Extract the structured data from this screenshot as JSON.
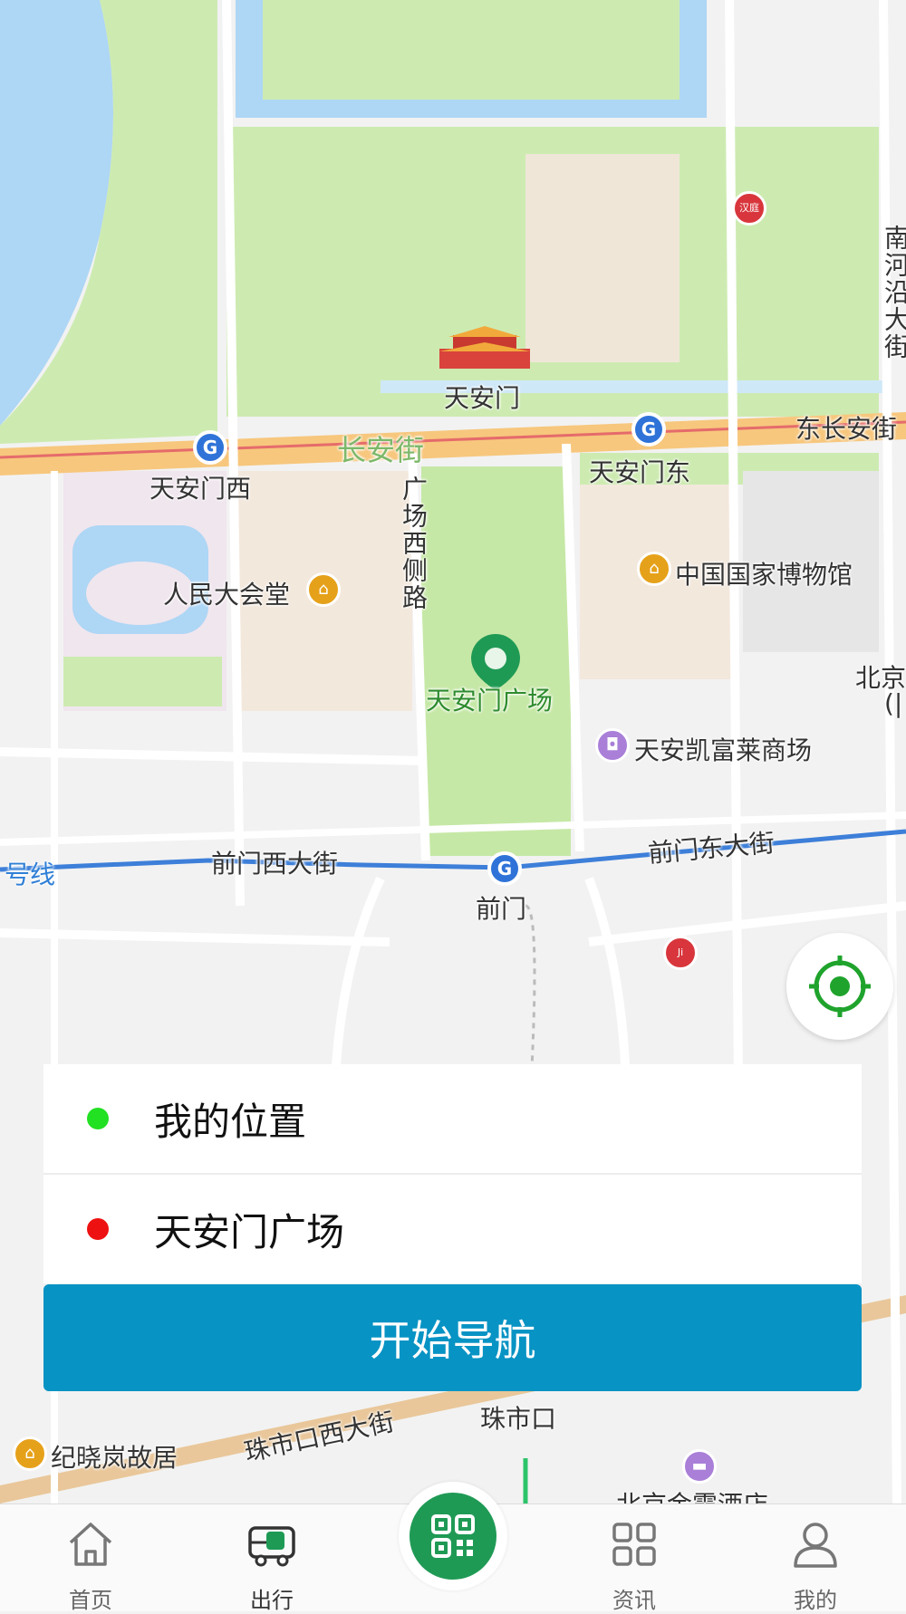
{
  "map": {
    "labels": {
      "tiananmen": "天安门",
      "changan_jie": "长安街",
      "dong_changan_jie": "东长安街",
      "tiananmen_xi": "天安门西",
      "tiananmen_dong": "天安门东",
      "guangchang_xi_ce_lu": "广场西侧路",
      "renmin_dahuitang": "人民大会堂",
      "guojia_bowuguan": "中国国家博物馆",
      "tiananmen_guangchang": "天安门广场",
      "tianan_kaifulai": "天安凯富莱商场",
      "qianmen_xi_dajie": "前门西大街",
      "qianmen_dong_dajie": "前门东大街",
      "qianmen": "前门",
      "hao_xian": "号线",
      "nanheyan_dajie": "南河沿大街",
      "beijing_partial": "北京",
      "beijing_paren": "(|",
      "zhushikou": "珠市口",
      "zhushikou_xi_dajie": "珠市口西大街",
      "jixiaolan_guju": "纪晓岚故居",
      "beijing_hotel_partial": "北京金霞酒店",
      "hanting": "汉庭"
    },
    "colors": {
      "water": "#aed6f5",
      "park": "#cdebb1",
      "road": "#ffffff",
      "main_road": "#f7c77d",
      "metro_line": "#3d7fd9",
      "land": "#f2f2f2"
    }
  },
  "route_panel": {
    "origin": "我的位置",
    "destination": "天安门广场",
    "origin_color": "#22e022",
    "destination_color": "#ee1111"
  },
  "navigate_button": "开始导航",
  "tabbar": {
    "items": [
      {
        "label": "首页",
        "icon": "home-icon"
      },
      {
        "label": "出行",
        "icon": "bus-icon"
      },
      {
        "label": "",
        "icon": "qr-code-icon"
      },
      {
        "label": "资讯",
        "icon": "grid-icon"
      },
      {
        "label": "我的",
        "icon": "user-icon"
      }
    ],
    "active_color": "#1f9a55"
  }
}
